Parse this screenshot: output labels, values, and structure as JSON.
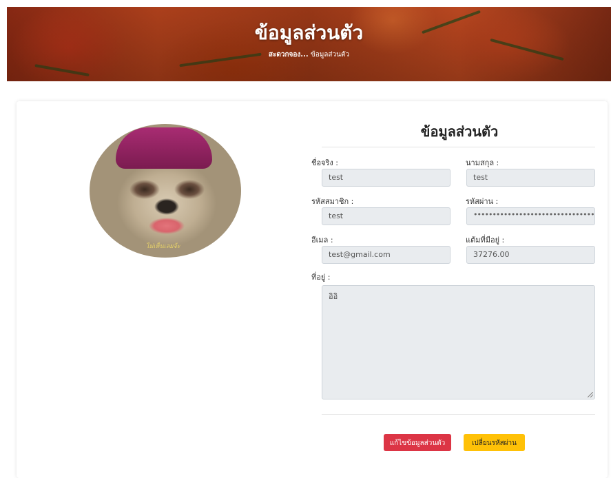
{
  "header": {
    "title": "ข้อมูลส่วนตัว",
    "breadcrumb_home": "สะดวกจอง...",
    "breadcrumb_current": "ข้อมูลส่วนตัว"
  },
  "profile": {
    "avatar_watermark": "ไม่เห็นเลยจ้ะ",
    "section_title": "ข้อมูลส่วนตัว",
    "fields": {
      "first_name_label": "ชื่อจริง :",
      "first_name_value": "test",
      "last_name_label": "นามสกุล :",
      "last_name_value": "test",
      "member_id_label": "รหัสสมาชิก :",
      "member_id_value": "test",
      "password_label": "รหัสผ่าน :",
      "password_value": "••••••••••••••••••••••••••••••••••••••••",
      "email_label": "อีเมล :",
      "email_value": "test@gmail.com",
      "points_label": "แต้มที่มีอยู่ :",
      "points_value": "37276.00",
      "address_label": "ที่อยู่ :",
      "address_value": "อิอิ"
    },
    "buttons": {
      "edit_label": "แก้ไขข้อมูลส่วนตัว",
      "change_password_label": "เปลี่ยนรหัสผ่าน"
    }
  }
}
